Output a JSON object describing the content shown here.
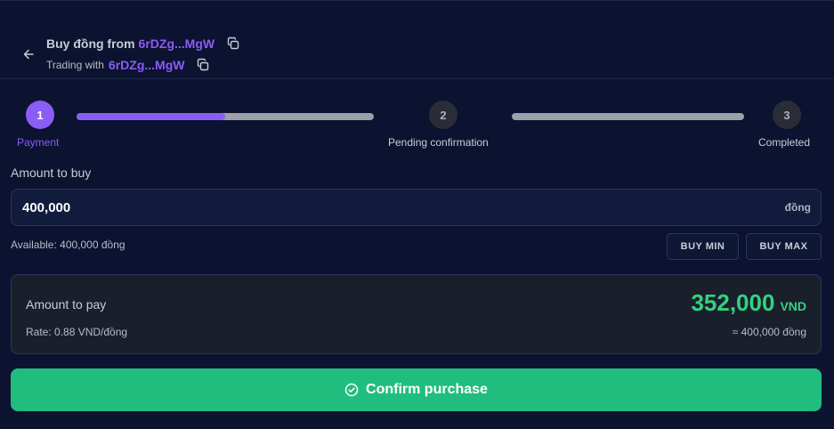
{
  "header": {
    "title_prefix": "Buy đồng from",
    "title_address": "6rDZg...MgW",
    "subtitle_prefix": "Trading with",
    "subtitle_address": "6rDZg...MgW",
    "icons": {
      "back": "arrow-left-icon",
      "copy": "copy-icon"
    }
  },
  "stepper": {
    "steps": [
      {
        "number": "1",
        "label": "Payment",
        "state": "active"
      },
      {
        "number": "2",
        "label": "Pending confirmation",
        "state": "inactive"
      },
      {
        "number": "3",
        "label": "Completed",
        "state": "inactive"
      }
    ],
    "progress": [
      0.5,
      0
    ]
  },
  "amount": {
    "label": "Amount to buy",
    "value": "400,000",
    "unit": "đồng",
    "available": "Available: 400,000 đồng",
    "buy_min": "BUY MIN",
    "buy_max": "BUY MAX"
  },
  "pay": {
    "label": "Amount to pay",
    "value": "352,000",
    "currency": "VND",
    "rate": "Rate: 0.88 VND/đồng",
    "approx": "≈ 400,000 đồng"
  },
  "confirm": {
    "label": "Confirm purchase",
    "icon": "check-circle-icon"
  },
  "colors": {
    "background": "#0b1330",
    "accent": "#8b5cf6",
    "success": "#21bd7f",
    "pay_value": "#34d17f"
  }
}
